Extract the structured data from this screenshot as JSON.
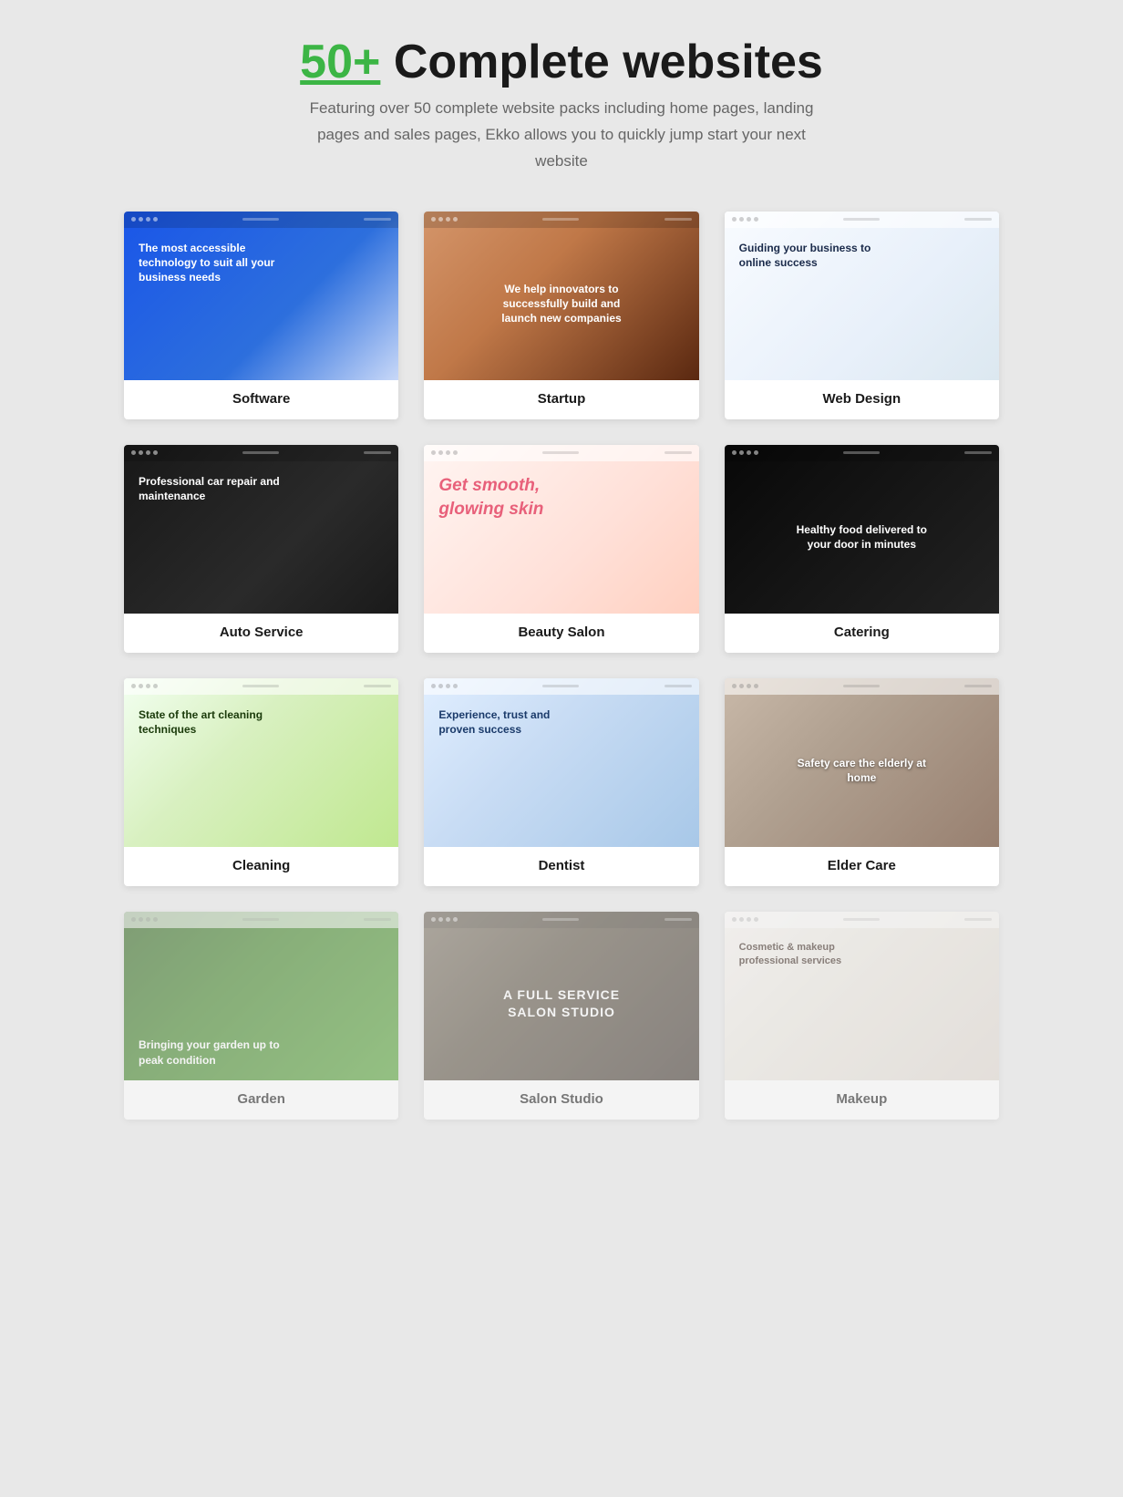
{
  "header": {
    "accent": "50+",
    "title": " Complete websites",
    "description": "Featuring over 50 complete website packs including home pages, landing pages and sales pages, Ekko allows you to quickly jump start your next website"
  },
  "grid": {
    "cards": [
      {
        "id": "software",
        "label": "Software",
        "theme": "software",
        "mockText": "The most accessible technology to suit all your business needs"
      },
      {
        "id": "startup",
        "label": "Startup",
        "theme": "startup",
        "mockText": "We help innovators to successfully build and launch new companies"
      },
      {
        "id": "webdesign",
        "label": "Web Design",
        "theme": "webdesign",
        "mockText": "Guiding your business to online success"
      },
      {
        "id": "auto",
        "label": "Auto Service",
        "theme": "auto",
        "mockText": "Professional car repair and maintenance"
      },
      {
        "id": "beauty",
        "label": "Beauty Salon",
        "theme": "beauty",
        "mockText": "Get smooth, glowing skin"
      },
      {
        "id": "catering",
        "label": "Catering",
        "theme": "catering",
        "mockText": "Healthy food delivered to your door in minutes"
      },
      {
        "id": "cleaning",
        "label": "Cleaning",
        "theme": "cleaning",
        "mockText": "State of the art cleaning techniques"
      },
      {
        "id": "dentist",
        "label": "Dentist",
        "theme": "dentist",
        "mockText": "Experience, trust and proven success"
      },
      {
        "id": "eldercare",
        "label": "Elder Care",
        "theme": "eldercare",
        "mockText": "Safety care the elderly at home"
      },
      {
        "id": "garden",
        "label": "Garden",
        "theme": "garden",
        "mockText": "Bringing your garden up to peak condition",
        "faded": true
      },
      {
        "id": "salon",
        "label": "Salon Studio",
        "theme": "salon",
        "mockText": "A FULL SERVICE SALON STUDIO",
        "faded": true
      },
      {
        "id": "makeup",
        "label": "Makeup",
        "theme": "makeup",
        "mockText": "Cosmetic & makeup professional services",
        "faded": true
      }
    ]
  }
}
